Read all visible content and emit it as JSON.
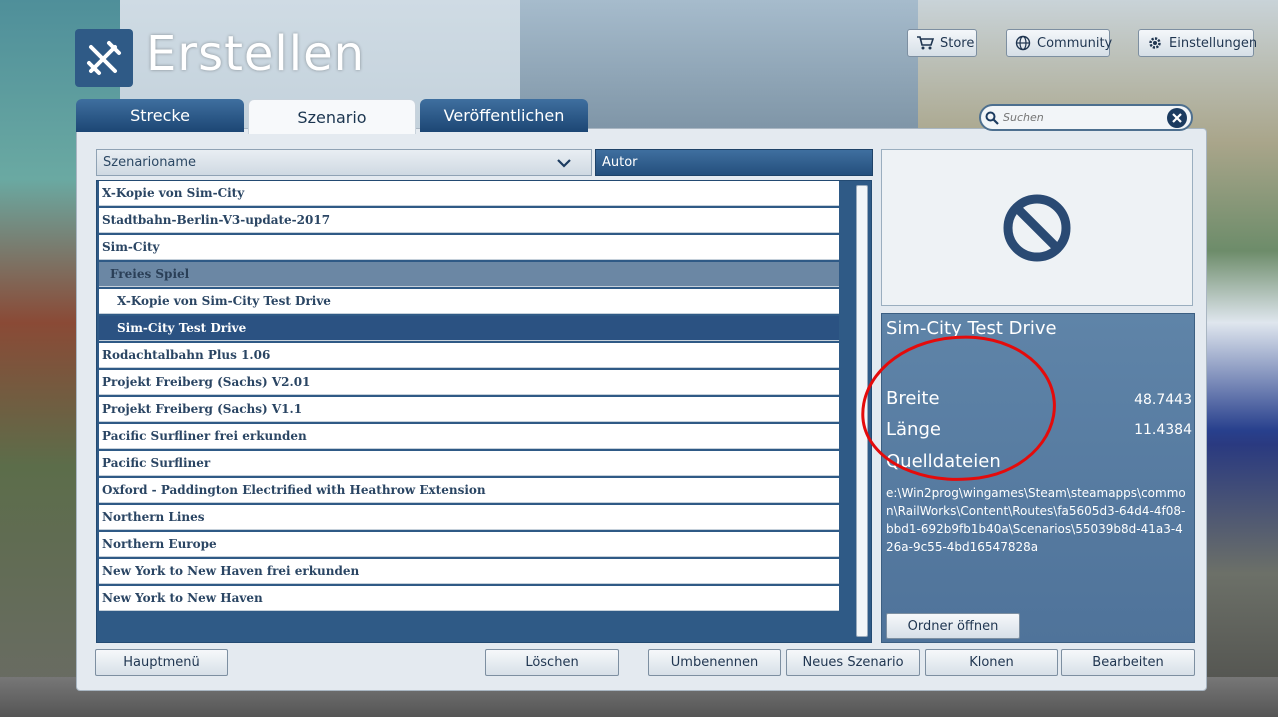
{
  "header": {
    "title": "Erstellen",
    "store_label": "Store",
    "community_label": "Community",
    "settings_label": "Einstellungen"
  },
  "tabs": [
    {
      "label": "Strecke",
      "active": false
    },
    {
      "label": "Szenario",
      "active": true
    },
    {
      "label": "Veröffentlichen",
      "active": false
    }
  ],
  "search": {
    "placeholder": "Suchen"
  },
  "sort": {
    "name_label": "Szenarioname",
    "author_label": "Autor"
  },
  "scenarios": [
    {
      "label": "X-Kopie von Sim-City",
      "kind": "route"
    },
    {
      "label": "Stadtbahn-Berlin-V3-update-2017",
      "kind": "route"
    },
    {
      "label": "Sim-City",
      "kind": "route"
    },
    {
      "label": "Freies Spiel",
      "kind": "group"
    },
    {
      "label": "X-Kopie von Sim-City Test Drive",
      "kind": "sub"
    },
    {
      "label": "Sim-City Test Drive",
      "kind": "sub-selected"
    },
    {
      "label": "Rodachtalbahn Plus 1.06",
      "kind": "route"
    },
    {
      "label": "Projekt Freiberg (Sachs) V2.01",
      "kind": "route"
    },
    {
      "label": "Projekt Freiberg (Sachs) V1.1",
      "kind": "route"
    },
    {
      "label": "Pacific Surfliner frei erkunden",
      "kind": "route"
    },
    {
      "label": "Pacific Surfliner",
      "kind": "route"
    },
    {
      "label": "Oxford - Paddington Electrified with Heathrow Extension",
      "kind": "route"
    },
    {
      "label": "Northern Lines",
      "kind": "route"
    },
    {
      "label": "Northern Europe",
      "kind": "route"
    },
    {
      "label": "New York to New Haven frei erkunden",
      "kind": "route"
    },
    {
      "label": "New York to New Haven",
      "kind": "route"
    }
  ],
  "info": {
    "title": "Sim-City Test Drive",
    "width_label": "Breite",
    "width_value": "48.7443",
    "length_label": "Länge",
    "length_value": "11.4384",
    "source_label": "Quelldateien",
    "source_path": "e:\\Win2prog\\wingames\\Steam\\steamapps\\common\\RailWorks\\Content\\Routes\\fa5605d3-64d4-4f08-bbd1-692b9fb1b40a\\Scenarios\\55039b8d-41a3-426a-9c55-4bd16547828a",
    "open_folder_label": "Ordner öffnen"
  },
  "footer": {
    "main_menu": "Hauptmenü",
    "delete": "Löschen",
    "rename": "Umbenennen",
    "new_scenario": "Neues Szenario",
    "clone": "Klonen",
    "edit": "Bearbeiten"
  },
  "colors": {
    "accent": "#2f5a86",
    "selected_row": "#2b5282",
    "annotation": "#e40b0b"
  }
}
